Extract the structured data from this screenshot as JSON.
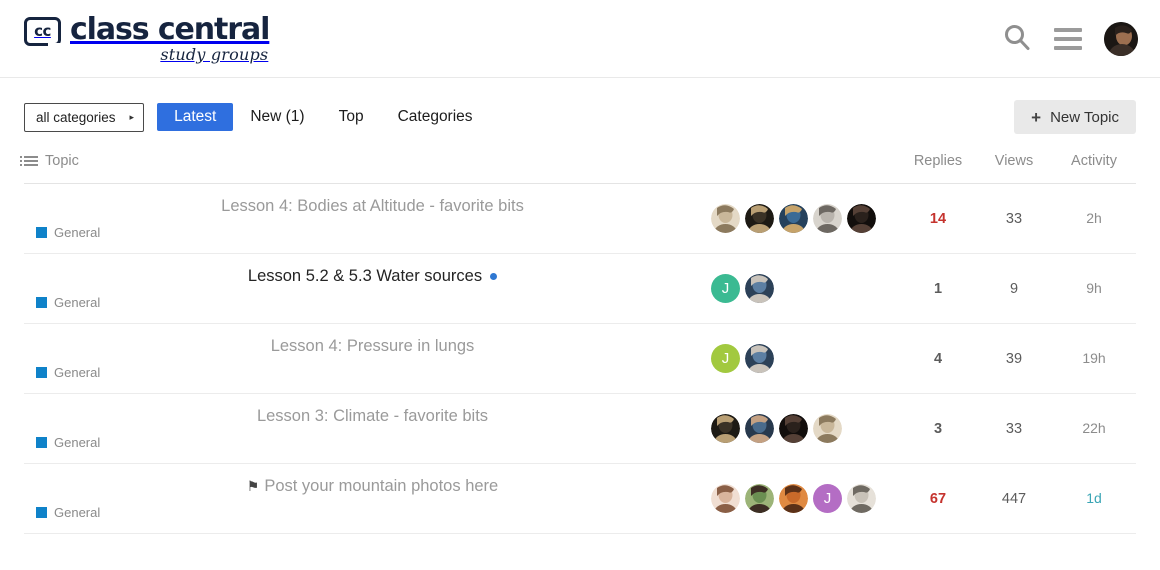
{
  "header": {
    "logo_mark_text": "cc",
    "logo_main": "class central",
    "logo_sub": "study groups",
    "search_icon": "search-icon",
    "menu_icon": "hamburger-menu-icon",
    "avatar_icon": "user-avatar"
  },
  "nav": {
    "category_filter": "all categories",
    "category_caret": "▸",
    "links": [
      {
        "label": "Latest",
        "active": true
      },
      {
        "label": "New (1)",
        "active": false
      },
      {
        "label": "Top",
        "active": false
      },
      {
        "label": "Categories",
        "active": false
      }
    ],
    "new_topic_plus": "+",
    "new_topic_label": "New Topic"
  },
  "table": {
    "columns": {
      "topic": "Topic",
      "replies": "Replies",
      "views": "Views",
      "activity": "Activity"
    },
    "rows": [
      {
        "title": "Lesson 4: Bodies at Altitude - favorite bits",
        "unread": false,
        "pinned": false,
        "new_dot": false,
        "category": "General",
        "category_color": "#0f82c9",
        "avatars": [
          {
            "type": "photo",
            "colors": [
              "#c9b79a",
              "#8c7a5e",
              "#e4d9c6"
            ]
          },
          {
            "type": "photo",
            "colors": [
              "#3a3226",
              "#b99f74",
              "#1d1a14"
            ]
          },
          {
            "type": "photo",
            "colors": [
              "#3b6b96",
              "#c6a36a",
              "#25415c"
            ]
          },
          {
            "type": "photo",
            "colors": [
              "#b9b4ad",
              "#6d6862",
              "#d8d4cd"
            ]
          },
          {
            "type": "photo",
            "colors": [
              "#2a211c",
              "#554036",
              "#120e0c"
            ]
          }
        ],
        "replies": "14",
        "replies_hot": true,
        "views": "33",
        "activity": "2h",
        "activity_recent": false
      },
      {
        "title": "Lesson 5.2 & 5.3 Water sources",
        "unread": true,
        "pinned": false,
        "new_dot": true,
        "category": "General",
        "category_color": "#0f82c9",
        "avatars": [
          {
            "type": "letter",
            "letter": "J",
            "color": "#3bba92"
          },
          {
            "type": "photo",
            "colors": [
              "#5c7fa3",
              "#c9c3bb",
              "#2c4158"
            ]
          }
        ],
        "replies": "1",
        "replies_hot": false,
        "views": "9",
        "activity": "9h",
        "activity_recent": false
      },
      {
        "title": "Lesson 4: Pressure in lungs",
        "unread": false,
        "pinned": false,
        "new_dot": false,
        "category": "General",
        "category_color": "#0f82c9",
        "avatars": [
          {
            "type": "letter",
            "letter": "J",
            "color": "#a2c93f"
          },
          {
            "type": "photo",
            "colors": [
              "#5c7fa3",
              "#c9c3bb",
              "#2c4158"
            ]
          }
        ],
        "replies": "4",
        "replies_hot": false,
        "views": "39",
        "activity": "19h",
        "activity_recent": false
      },
      {
        "title": "Lesson 3: Climate - favorite bits",
        "unread": false,
        "pinned": false,
        "new_dot": false,
        "category": "General",
        "category_color": "#0f82c9",
        "avatars": [
          {
            "type": "photo",
            "colors": [
              "#3a3226",
              "#b99f74",
              "#1d1a14"
            ]
          },
          {
            "type": "photo",
            "colors": [
              "#4a6b8c",
              "#c4a183",
              "#28394d"
            ]
          },
          {
            "type": "photo",
            "colors": [
              "#2a211c",
              "#554036",
              "#120e0c"
            ]
          },
          {
            "type": "photo",
            "colors": [
              "#c9b79a",
              "#8c7a5e",
              "#e4d9c6"
            ]
          }
        ],
        "replies": "3",
        "replies_hot": false,
        "views": "33",
        "activity": "22h",
        "activity_recent": false
      },
      {
        "title": "Post your mountain photos here",
        "unread": false,
        "pinned": true,
        "pin_icon": "⚑",
        "new_dot": false,
        "category": "General",
        "category_color": "#0f82c9",
        "avatars": [
          {
            "type": "photo",
            "colors": [
              "#d8b49c",
              "#8a5f46",
              "#f0ded2"
            ]
          },
          {
            "type": "photo",
            "colors": [
              "#6b8f52",
              "#3d2e24",
              "#9cb478"
            ]
          },
          {
            "type": "photo",
            "colors": [
              "#c96a2a",
              "#5b3118",
              "#e08a42"
            ]
          },
          {
            "type": "letter",
            "letter": "J",
            "color": "#b46dc4"
          },
          {
            "type": "photo",
            "colors": [
              "#c8c2b8",
              "#6f6a62",
              "#e6e1d9"
            ]
          }
        ],
        "replies": "67",
        "replies_hot": true,
        "views": "447",
        "activity": "1d",
        "activity_recent": true
      }
    ]
  }
}
